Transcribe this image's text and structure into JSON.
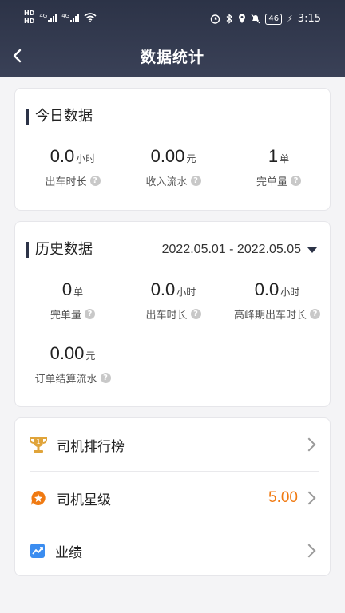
{
  "status": {
    "left_hd1": "HD",
    "left_hd2": "HD",
    "net1": "4G",
    "net2": "4G",
    "battery": "46",
    "time": "3:15"
  },
  "header": {
    "title": "数据统计"
  },
  "today": {
    "title": "今日数据",
    "stats": [
      {
        "value": "0.0",
        "unit": "小时",
        "label": "出车时长"
      },
      {
        "value": "0.00",
        "unit": "元",
        "label": "收入流水"
      },
      {
        "value": "1",
        "unit": "单",
        "label": "完单量"
      }
    ]
  },
  "history": {
    "title": "历史数据",
    "date_range": "2022.05.01 - 2022.05.05",
    "stats": [
      {
        "value": "0",
        "unit": "单",
        "label": "完单量"
      },
      {
        "value": "0.0",
        "unit": "小时",
        "label": "出车时长"
      },
      {
        "value": "0.0",
        "unit": "小时",
        "label": "高峰期出车时长"
      },
      {
        "value": "0.00",
        "unit": "元",
        "label": "订单结算流水"
      }
    ]
  },
  "menu": [
    {
      "label": "司机排行榜",
      "icon": "trophy-icon",
      "value": ""
    },
    {
      "label": "司机星级",
      "icon": "star-badge-icon",
      "value": "5.00"
    },
    {
      "label": "业绩",
      "icon": "trend-chart-icon",
      "value": ""
    }
  ],
  "colors": {
    "header_bg": "#2c3347",
    "accent": "#f07a12",
    "trophy": "#e0a43a",
    "chart_icon": "#3b8df0"
  }
}
